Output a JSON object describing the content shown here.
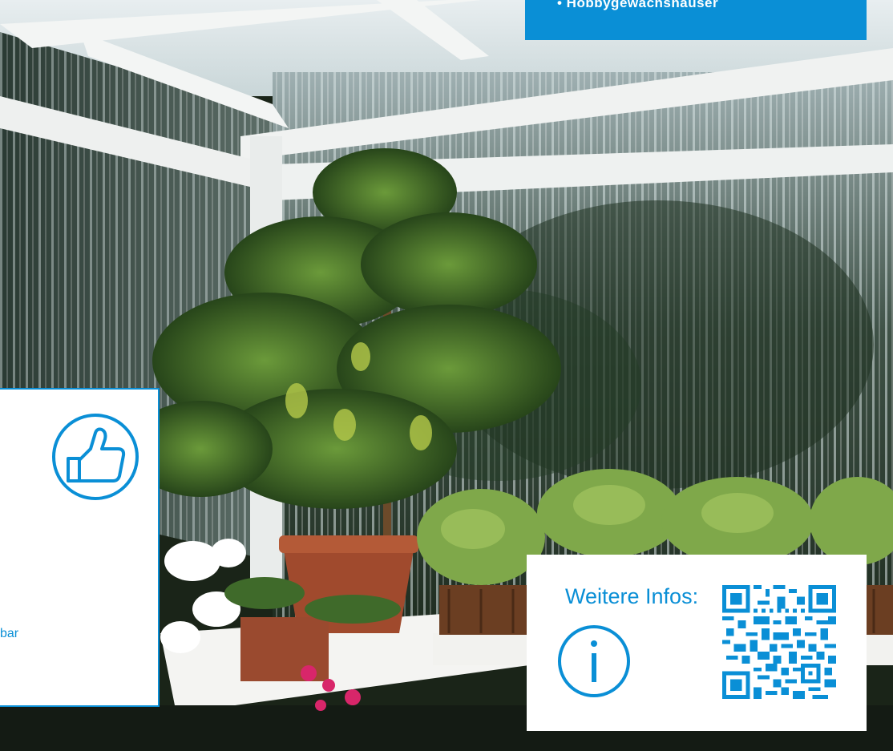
{
  "top_box": {
    "item": "• Hobbygewächshäuser"
  },
  "left_panel": {
    "partial_text": "bar",
    "icon": "thumbs-up-icon"
  },
  "info_box": {
    "heading": "Weitere Infos:",
    "icon": "info-icon",
    "qr": "qr-code"
  },
  "colors": {
    "accent": "#0a8fd6",
    "panel": "#ffffff"
  }
}
